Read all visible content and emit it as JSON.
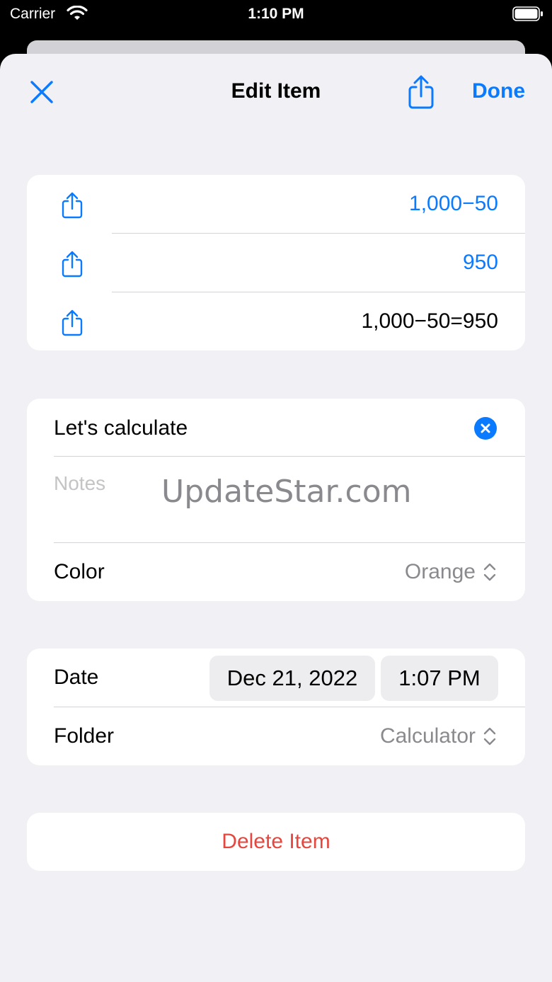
{
  "status_bar": {
    "carrier": "Carrier",
    "time": "1:10 PM"
  },
  "nav": {
    "title": "Edit Item",
    "done_label": "Done"
  },
  "results": [
    {
      "value": "1,000−50",
      "color": "blue"
    },
    {
      "value": "950",
      "color": "blue"
    },
    {
      "value": "1,000−50=950",
      "color": "black"
    }
  ],
  "details": {
    "title_value": "Let's calculate",
    "notes_placeholder": "Notes",
    "color_label": "Color",
    "color_value": "Orange"
  },
  "watermark": "UpdateStar.com",
  "schedule": {
    "date_label": "Date",
    "date_value": "Dec 21, 2022",
    "time_value": "1:07 PM",
    "folder_label": "Folder",
    "folder_value": "Calculator"
  },
  "actions": {
    "delete_label": "Delete Item"
  },
  "colors": {
    "accent": "#0a7aff",
    "destructive": "#e5463d",
    "background": "#f0f0f5",
    "secondary_text": "#8a8a8e"
  }
}
